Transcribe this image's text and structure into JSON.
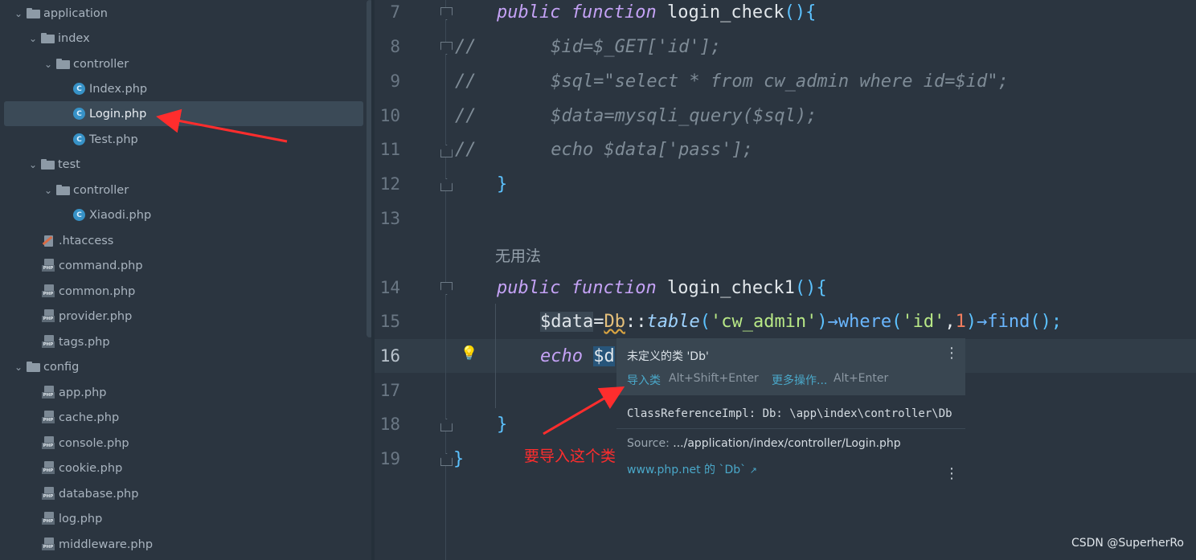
{
  "tree": {
    "items": [
      {
        "label": "application",
        "type": "folder",
        "open": true
      },
      {
        "label": "index",
        "type": "folder",
        "open": true
      },
      {
        "label": "controller",
        "type": "folder",
        "open": true
      },
      {
        "label": "Index.php",
        "type": "class-file"
      },
      {
        "label": "Login.php",
        "type": "class-file",
        "selected": true
      },
      {
        "label": "Test.php",
        "type": "class-file"
      },
      {
        "label": "test",
        "type": "folder",
        "open": true
      },
      {
        "label": "controller",
        "type": "folder",
        "open": true
      },
      {
        "label": "Xiaodi.php",
        "type": "class-file"
      },
      {
        "label": ".htaccess",
        "type": "htaccess-file"
      },
      {
        "label": "command.php",
        "type": "php-file"
      },
      {
        "label": "common.php",
        "type": "php-file"
      },
      {
        "label": "provider.php",
        "type": "php-file"
      },
      {
        "label": "tags.php",
        "type": "php-file"
      },
      {
        "label": "config",
        "type": "folder",
        "open": true
      },
      {
        "label": "app.php",
        "type": "php-file"
      },
      {
        "label": "cache.php",
        "type": "php-file"
      },
      {
        "label": "console.php",
        "type": "php-file"
      },
      {
        "label": "cookie.php",
        "type": "php-file"
      },
      {
        "label": "database.php",
        "type": "php-file"
      },
      {
        "label": "log.php",
        "type": "php-file"
      },
      {
        "label": "middleware.php",
        "type": "php-file"
      }
    ],
    "class_icon_letter": "C",
    "php_icon_tag": "PHP"
  },
  "editor": {
    "line_numbers": [
      "7",
      "8",
      "9",
      "10",
      "11",
      "12",
      "13",
      "14",
      "15",
      "16",
      "17",
      "18",
      "19"
    ],
    "current_line": "16",
    "code": {
      "l7_kw1": "public",
      "l7_kw2": "function",
      "l7_name": " login_check",
      "l7_brace": "(){",
      "l8_cm": "//       $id=$_GET['id'];",
      "l9_cm": "//       $sql=\"select * from cw_admin where id=$id\";",
      "l10_cm": "//       $data=mysqli_query($sql);",
      "l11_cm": "//       echo $data['pass'];",
      "l12_brace": "}",
      "inlay_hint": "无用法",
      "l14_kw1": "public",
      "l14_kw2": "function",
      "l14_name": " login_check1",
      "l14_brace": "(){",
      "l15_var": "$data",
      "l15_eq": "=",
      "l15_cls": "Db",
      "l15_sep": "::",
      "l15_tbl": "table",
      "l15_p1": "(",
      "l15_s1": "'cw_admin'",
      "l15_p2": ")",
      "l15_arrow1": "→",
      "l15_where": "where",
      "l15_p3": "(",
      "l15_s2": "'id'",
      "l15_comma": ",",
      "l15_n1": "1",
      "l15_p4": ")",
      "l15_arrow2": "→",
      "l15_find": "find",
      "l15_end": "();",
      "l16_kw": "echo",
      "l16_var": "$d",
      "l18_brace": "}",
      "l19_brace": "}"
    }
  },
  "popup": {
    "title": "未定义的类 'Db'",
    "import_action": "导入类",
    "import_shortcut": "Alt+Shift+Enter",
    "more_action": "更多操作...",
    "more_shortcut": "Alt+Enter",
    "reference": "ClassReferenceImpl: Db: \\app\\index\\controller\\Db",
    "source_label": "Source:",
    "source_path": ".../application/index/controller/Login.php",
    "doc_link": "www.php.net 的 `Db`",
    "doc_link_icon": "↗",
    "menu_icon": "⋮"
  },
  "annotation": {
    "text": "要导入这个类",
    "color": "#ff2d2d"
  },
  "watermark": "CSDN @SuperherRo",
  "bulb_icon": "💡"
}
